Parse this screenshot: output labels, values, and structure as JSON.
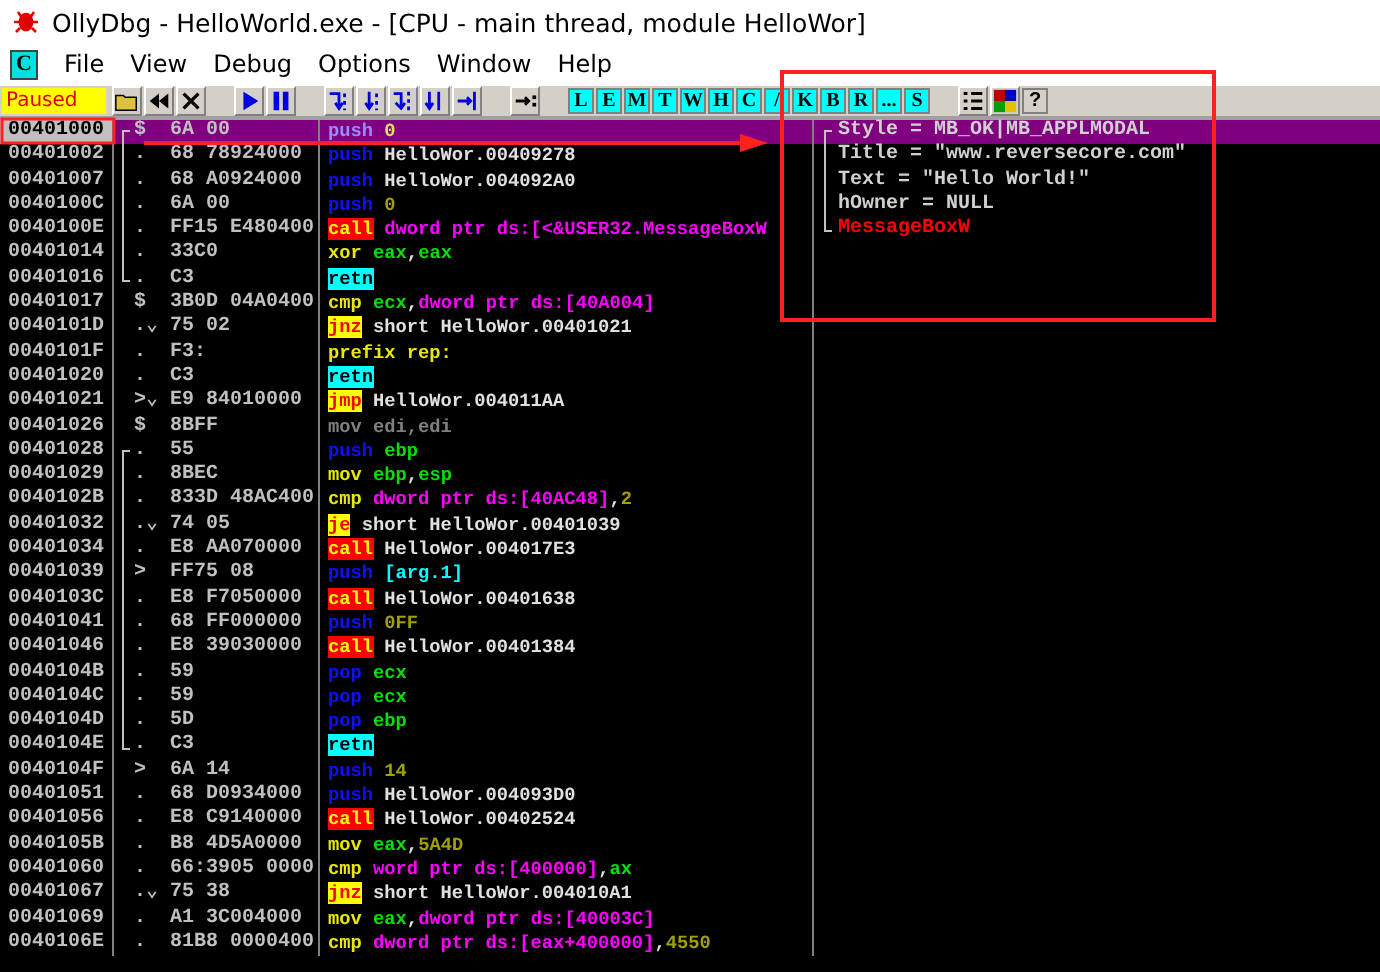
{
  "window": {
    "title": "OllyDbg - HelloWorld.exe - [CPU - main thread, module HelloWor]"
  },
  "menu": {
    "icon_letter": "C",
    "items": [
      "File",
      "View",
      "Debug",
      "Options",
      "Window",
      "Help"
    ]
  },
  "toolbar": {
    "status": "Paused",
    "letters": [
      "L",
      "E",
      "M",
      "T",
      "W",
      "H",
      "C",
      "/",
      "K",
      "B",
      "R",
      "...",
      "S"
    ],
    "help": "?"
  },
  "blocks": [
    {
      "bracketed": true,
      "rows": [
        {
          "address": "00401000",
          "marker": "$",
          "hex": "6A 00",
          "mnemonic": "push",
          "kind": "push",
          "operands": [
            {
              "text": "0",
              "kind": "const"
            }
          ],
          "comment": {
            "text": "Style = MB_OK|MB_APPLMODAL",
            "kind": "arg"
          },
          "selected": true
        },
        {
          "address": "00401002",
          "marker": ".",
          "hex": "68 78924000",
          "mnemonic": "push",
          "kind": "push",
          "operands": [
            {
              "text": "HelloWor.00409278",
              "kind": "label"
            }
          ],
          "comment": {
            "text": "Title = \"www.reversecore.com\"",
            "kind": "arg"
          },
          "selected": false
        },
        {
          "address": "00401007",
          "marker": ".",
          "hex": "68 A0924000",
          "mnemonic": "push",
          "kind": "push",
          "operands": [
            {
              "text": "HelloWor.004092A0",
              "kind": "label"
            }
          ],
          "comment": {
            "text": "Text = \"Hello World!\"",
            "kind": "arg"
          },
          "selected": false
        },
        {
          "address": "0040100C",
          "marker": ".",
          "hex": "6A 00",
          "mnemonic": "push",
          "kind": "push",
          "operands": [
            {
              "text": "0",
              "kind": "const"
            }
          ],
          "comment": {
            "text": "hOwner = NULL",
            "kind": "arg"
          },
          "selected": false
        },
        {
          "address": "0040100E",
          "marker": ".",
          "hex": "FF15 E480400",
          "mnemonic": "call",
          "kind": "call",
          "operands": [
            {
              "text": "dword ptr ds:[<&USER32.MessageBoxW",
              "kind": "mem"
            }
          ],
          "comment": {
            "text": "MessageBoxW",
            "kind": "call"
          },
          "selected": false
        },
        {
          "address": "00401014",
          "marker": ".",
          "hex": "33C0",
          "mnemonic": "xor",
          "kind": "op",
          "operands": [
            {
              "text": "eax",
              "kind": "reg"
            },
            {
              "text": ",",
              "kind": "punct"
            },
            {
              "text": "eax",
              "kind": "reg"
            }
          ],
          "selected": false
        },
        {
          "address": "00401016",
          "marker": ".",
          "hex": "C3",
          "mnemonic": "retn",
          "kind": "retn",
          "operands": [],
          "selected": false
        }
      ]
    },
    {
      "bracketed": false,
      "rows": [
        {
          "address": "00401017",
          "marker": "$",
          "hex": "3B0D 04A0400",
          "mnemonic": "cmp",
          "kind": "op",
          "operands": [
            {
              "text": "ecx",
              "kind": "reg"
            },
            {
              "text": ",",
              "kind": "punct"
            },
            {
              "text": "dword ptr ds:[40A004]",
              "kind": "mem"
            }
          ],
          "selected": false
        },
        {
          "address": "0040101D",
          "marker": ".⌄",
          "hex": "75 02",
          "mnemonic": "jnz",
          "kind": "jump",
          "operands": [
            {
              "text": "short HelloWor.00401021",
              "kind": "label"
            }
          ],
          "selected": false
        },
        {
          "address": "0040101F",
          "marker": ".",
          "hex": "F3:",
          "mnemonic": "prefix rep:",
          "kind": "op",
          "operands": [],
          "selected": false
        },
        {
          "address": "00401020",
          "marker": ".",
          "hex": "C3",
          "mnemonic": "retn",
          "kind": "retn",
          "operands": [],
          "selected": false
        },
        {
          "address": "00401021",
          "marker": ">⌄",
          "hex": "E9 84010000",
          "mnemonic": "jmp",
          "kind": "jump",
          "operands": [
            {
              "text": "HelloWor.004011AA",
              "kind": "label"
            }
          ],
          "selected": false
        },
        {
          "address": "00401026",
          "marker": "$",
          "hex": "8BFF",
          "mnemonic": "mov",
          "kind": "filler",
          "operands": [
            {
              "text": "edi,edi",
              "kind": "filler"
            }
          ],
          "selected": false
        }
      ]
    },
    {
      "bracketed": true,
      "rows": [
        {
          "address": "00401028",
          "marker": ".",
          "hex": "55",
          "mnemonic": "push",
          "kind": "push",
          "operands": [
            {
              "text": "ebp",
              "kind": "reg"
            }
          ],
          "selected": false
        },
        {
          "address": "00401029",
          "marker": ".",
          "hex": "8BEC",
          "mnemonic": "mov",
          "kind": "op",
          "operands": [
            {
              "text": "ebp",
              "kind": "reg"
            },
            {
              "text": ",",
              "kind": "punct"
            },
            {
              "text": "esp",
              "kind": "reg"
            }
          ],
          "selected": false
        },
        {
          "address": "0040102B",
          "marker": ".",
          "hex": "833D 48AC400",
          "mnemonic": "cmp",
          "kind": "op",
          "operands": [
            {
              "text": "dword ptr ds:[40AC48]",
              "kind": "mem"
            },
            {
              "text": ",",
              "kind": "punct"
            },
            {
              "text": "2",
              "kind": "const"
            }
          ],
          "selected": false
        },
        {
          "address": "00401032",
          "marker": ".⌄",
          "hex": "74 05",
          "mnemonic": "je",
          "kind": "jump",
          "operands": [
            {
              "text": "short HelloWor.00401039",
              "kind": "label"
            }
          ],
          "selected": false
        },
        {
          "address": "00401034",
          "marker": ".",
          "hex": "E8 AA070000",
          "mnemonic": "call",
          "kind": "call",
          "operands": [
            {
              "text": "HelloWor.004017E3",
              "kind": "label"
            }
          ],
          "selected": false
        },
        {
          "address": "00401039",
          "marker": ">",
          "hex": "FF75 08",
          "mnemonic": "push",
          "kind": "push",
          "operands": [
            {
              "text": "[arg.1]",
              "kind": "arg"
            }
          ],
          "selected": false
        },
        {
          "address": "0040103C",
          "marker": ".",
          "hex": "E8 F7050000",
          "mnemonic": "call",
          "kind": "call",
          "operands": [
            {
              "text": "HelloWor.00401638",
              "kind": "label"
            }
          ],
          "selected": false
        },
        {
          "address": "00401041",
          "marker": ".",
          "hex": "68 FF000000",
          "mnemonic": "push",
          "kind": "push",
          "operands": [
            {
              "text": "0FF",
              "kind": "const"
            }
          ],
          "selected": false
        },
        {
          "address": "00401046",
          "marker": ".",
          "hex": "E8 39030000",
          "mnemonic": "call",
          "kind": "call",
          "operands": [
            {
              "text": "HelloWor.00401384",
              "kind": "label"
            }
          ],
          "selected": false
        },
        {
          "address": "0040104B",
          "marker": ".",
          "hex": "59",
          "mnemonic": "pop",
          "kind": "push",
          "operands": [
            {
              "text": "ecx",
              "kind": "reg"
            }
          ],
          "selected": false
        },
        {
          "address": "0040104C",
          "marker": ".",
          "hex": "59",
          "mnemonic": "pop",
          "kind": "push",
          "operands": [
            {
              "text": "ecx",
              "kind": "reg"
            }
          ],
          "selected": false
        },
        {
          "address": "0040104D",
          "marker": ".",
          "hex": "5D",
          "mnemonic": "pop",
          "kind": "push",
          "operands": [
            {
              "text": "ebp",
              "kind": "reg"
            }
          ],
          "selected": false
        },
        {
          "address": "0040104E",
          "marker": ".",
          "hex": "C3",
          "mnemonic": "retn",
          "kind": "retn",
          "operands": [],
          "selected": false
        }
      ]
    },
    {
      "bracketed": false,
      "rows": [
        {
          "address": "0040104F",
          "marker": ">",
          "hex": "6A 14",
          "mnemonic": "push",
          "kind": "push",
          "operands": [
            {
              "text": "14",
              "kind": "const"
            }
          ],
          "selected": false
        },
        {
          "address": "00401051",
          "marker": ".",
          "hex": "68 D0934000",
          "mnemonic": "push",
          "kind": "push",
          "operands": [
            {
              "text": "HelloWor.004093D0",
              "kind": "label"
            }
          ],
          "selected": false
        },
        {
          "address": "00401056",
          "marker": ".",
          "hex": "E8 C9140000",
          "mnemonic": "call",
          "kind": "call",
          "operands": [
            {
              "text": "HelloWor.00402524",
              "kind": "label"
            }
          ],
          "selected": false
        },
        {
          "address": "0040105B",
          "marker": ".",
          "hex": "B8 4D5A0000",
          "mnemonic": "mov",
          "kind": "op",
          "operands": [
            {
              "text": "eax",
              "kind": "reg"
            },
            {
              "text": ",",
              "kind": "punct"
            },
            {
              "text": "5A4D",
              "kind": "const"
            }
          ],
          "selected": false
        },
        {
          "address": "00401060",
          "marker": ".",
          "hex": "66:3905 0000",
          "mnemonic": "cmp",
          "kind": "op",
          "operands": [
            {
              "text": "word ptr ds:[400000]",
              "kind": "mem"
            },
            {
              "text": ",",
              "kind": "punct"
            },
            {
              "text": "ax",
              "kind": "reg"
            }
          ],
          "selected": false
        },
        {
          "address": "00401067",
          "marker": ".⌄",
          "hex": "75 38",
          "mnemonic": "jnz",
          "kind": "jump",
          "operands": [
            {
              "text": "short HelloWor.004010A1",
              "kind": "label"
            }
          ],
          "selected": false
        },
        {
          "address": "00401069",
          "marker": ".",
          "hex": "A1 3C004000",
          "mnemonic": "mov",
          "kind": "op",
          "operands": [
            {
              "text": "eax",
              "kind": "reg"
            },
            {
              "text": ",",
              "kind": "punct"
            },
            {
              "text": "dword ptr ds:[40003C]",
              "kind": "mem"
            }
          ],
          "selected": false
        },
        {
          "address": "0040106E",
          "marker": ".",
          "hex": "81B8 0000400",
          "mnemonic": "cmp",
          "kind": "op",
          "operands": [
            {
              "text": "dword ptr ds:[eax+400000]",
              "kind": "mem"
            },
            {
              "text": ",",
              "kind": "punct"
            },
            {
              "text": "4550",
              "kind": "const"
            }
          ],
          "selected": false
        }
      ]
    }
  ]
}
